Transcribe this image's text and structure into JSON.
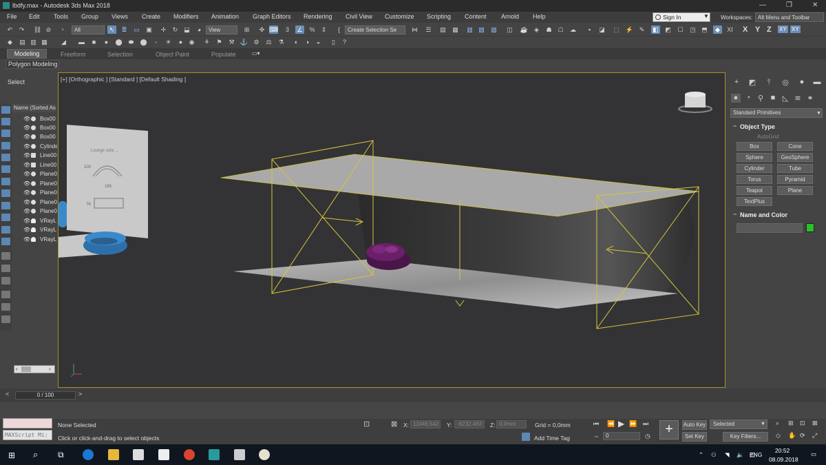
{
  "window": {
    "title": "lbdfy.max - Autodesk 3ds Max 2018",
    "min": "—",
    "max": "❐",
    "close": "✕"
  },
  "menu": [
    "File",
    "Edit",
    "Tools",
    "Group",
    "Views",
    "Create",
    "Modifiers",
    "Animation",
    "Graph Editors",
    "Rendering",
    "Civil View",
    "Customize",
    "Scripting",
    "Content",
    "Arnold",
    "Help"
  ],
  "signin": "Sign In",
  "workspaces_label": "Workspaces:",
  "workspace_value": "Alt Menu and Toolbar",
  "toolbar": {
    "filter": "All",
    "refcoord": "View",
    "selset": "Create Selection Se",
    "axes": [
      "X",
      "Y",
      "Z",
      "XY",
      "XY"
    ]
  },
  "ribbon": {
    "tabs": [
      "Modeling",
      "Freeform",
      "Selection",
      "Object Paint",
      "Populate"
    ],
    "panel": "Polygon Modeling"
  },
  "scene": {
    "select_label": "Select",
    "column": "Name (Sorted As",
    "items": [
      "Box00",
      "Box00",
      "Box00",
      "Cylinde",
      "Line00",
      "Line00",
      "Plane0",
      "Plane0",
      "Plane0",
      "Plane0",
      "Plane0",
      "VRayL",
      "VRayL",
      "VRayL"
    ]
  },
  "viewport": {
    "label": "[+] [Orthographic ] [Standard ] [Default Shading ]",
    "poster_title": "Lounge sofa ...",
    "dims": [
      "100",
      "165",
      "76"
    ]
  },
  "cmd": {
    "category": "Standard Primitives",
    "object_type": "Object Type",
    "autogrid": "AutoGrid",
    "buttons": [
      "Box",
      "Cone",
      "Sphere",
      "GeoSphere",
      "Cylinder",
      "Tube",
      "Torus",
      "Pyramid",
      "Teapot",
      "Plane",
      "TextPlus"
    ],
    "name_color": "Name and Color",
    "color": "#27c227"
  },
  "time": {
    "slider": "0 / 100"
  },
  "status": {
    "selection": "None Selected",
    "prompt": "Click or click-and-drag to select objects",
    "maxscript": "MAXScript Mi:",
    "x_label": "X:",
    "x_val": "11046,542",
    "y_label": "Y:",
    "y_val": "-8232,463",
    "z_label": "Z:",
    "z_val": "0,0mm",
    "grid": "Grid = 0,0mm",
    "add_time_tag": "Add Time Tag",
    "auto_key": "Auto Key",
    "selected": "Selected",
    "set_key": "Set Key",
    "key_filters": "Key Filters...",
    "frame": "0"
  },
  "taskbar": {
    "lang": "ENG",
    "time": "20:52",
    "date": "08.09.2018"
  }
}
